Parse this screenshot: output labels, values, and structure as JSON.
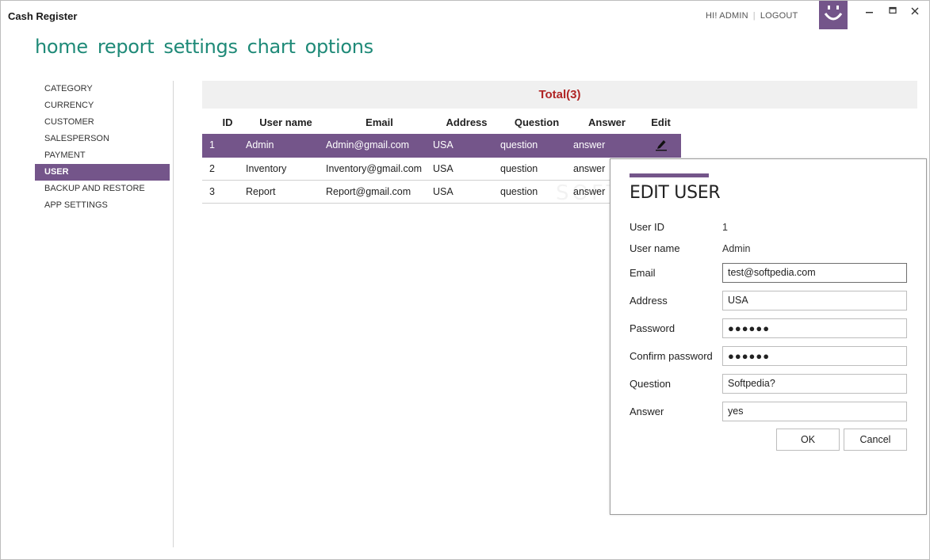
{
  "window": {
    "title": "Cash Register"
  },
  "userbar": {
    "greeting": "HI! ADMIN",
    "logout": "LOGOUT"
  },
  "topnav": [
    "home",
    "report",
    "settings",
    "chart",
    "options"
  ],
  "sidebar": {
    "items": [
      "CATEGORY",
      "CURRENCY",
      "CUSTOMER",
      "SALESPERSON",
      "PAYMENT",
      "USER",
      "BACKUP AND RESTORE",
      "APP SETTINGS"
    ],
    "active": "USER"
  },
  "table": {
    "total_label": "Total(3)",
    "columns": [
      "ID",
      "User name",
      "Email",
      "Address",
      "Question",
      "Answer",
      "Edit"
    ],
    "rows": [
      {
        "id": "1",
        "username": "Admin",
        "email": "Admin@gmail.com",
        "address": "USA",
        "question": "question",
        "answer": "answer"
      },
      {
        "id": "2",
        "username": "Inventory",
        "email": "Inventory@gmail.com",
        "address": "USA",
        "question": "question",
        "answer": "answer"
      },
      {
        "id": "3",
        "username": "Report",
        "email": "Report@gmail.com",
        "address": "USA",
        "question": "question",
        "answer": "answer"
      }
    ]
  },
  "watermark": "SOFTPEDIA",
  "dialog": {
    "title": "EDIT USER",
    "labels": {
      "user_id": "User ID",
      "username": "User name",
      "email": "Email",
      "address": "Address",
      "password": "Password",
      "confirm_password": "Confirm password",
      "question": "Question",
      "answer": "Answer"
    },
    "values": {
      "user_id": "1",
      "username": "Admin",
      "email": "test@softpedia.com",
      "address": "USA",
      "password": "●●●●●●",
      "confirm_password": "●●●●●●",
      "question": "Softpedia?",
      "answer": "yes"
    },
    "ok_label": "OK",
    "cancel_label": "Cancel"
  },
  "colors": {
    "accent": "#74558a",
    "nav": "#1f8a78",
    "total": "#b02525"
  },
  "icons": {
    "edit": "pencil-icon",
    "smiley": "smiley-icon"
  }
}
